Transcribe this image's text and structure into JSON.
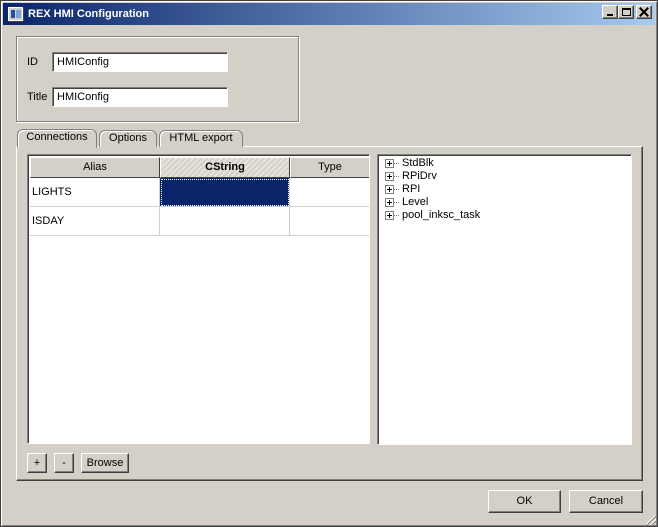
{
  "window": {
    "title": "REX HMI Configuration",
    "icon": "rex-hmi-app-icon",
    "controls": [
      "minimize-icon",
      "maximize-icon",
      "close-icon"
    ]
  },
  "form": {
    "id_label": "ID",
    "id_value": "HMIConfig",
    "title_label": "Title",
    "title_value": "HMIConfig"
  },
  "tabs": [
    {
      "label": "Connections",
      "active": true
    },
    {
      "label": "Options",
      "active": false
    },
    {
      "label": "HTML export",
      "active": false
    }
  ],
  "table": {
    "columns": [
      "Alias",
      "CString",
      "Type"
    ],
    "sorted_column": "CString",
    "rows": [
      {
        "alias": "LIGHTS",
        "cstring": "",
        "type": ""
      },
      {
        "alias": "ISDAY",
        "cstring": "",
        "type": ""
      }
    ],
    "selection_color": "#0a246a"
  },
  "tree": {
    "items": [
      "StdBlk",
      "RPiDrv",
      "RPI",
      "Level",
      "pool_inksc_task"
    ],
    "expander_icon": "plus-box-icon"
  },
  "buttons": {
    "add": "+",
    "remove": "-",
    "browse": "Browse",
    "ok": "OK",
    "cancel": "Cancel"
  },
  "colors": {
    "titlebar_start": "#0a246a",
    "titlebar_end": "#a6caf0",
    "face": "#d4d0c8"
  }
}
